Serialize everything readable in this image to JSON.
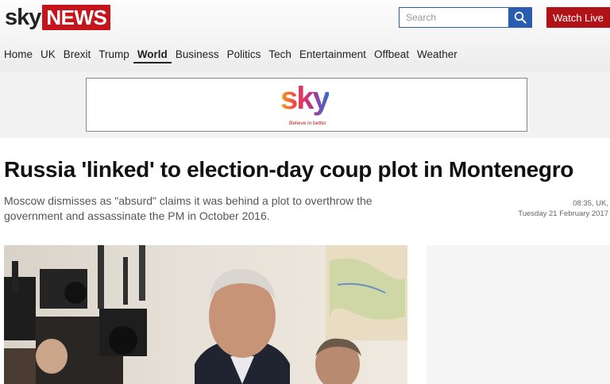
{
  "header": {
    "logo": {
      "sky": "sky",
      "news": "NEWS"
    },
    "search": {
      "placeholder": "Search"
    },
    "watch_live": "Watch Live",
    "nav": [
      {
        "label": "Home"
      },
      {
        "label": "UK"
      },
      {
        "label": "Brexit"
      },
      {
        "label": "Trump"
      },
      {
        "label": "World",
        "active": true
      },
      {
        "label": "Business"
      },
      {
        "label": "Politics"
      },
      {
        "label": "Tech"
      },
      {
        "label": "Entertainment"
      },
      {
        "label": "Offbeat"
      },
      {
        "label": "Weather"
      }
    ]
  },
  "ad": {
    "logo": "sky",
    "tagline": "Believe in better"
  },
  "article": {
    "headline": "Russia 'linked' to election-day coup plot in Montenegro",
    "standfirst": "Moscow dismisses as \"absurd\" claims it was behind a plot to overthrow the government and assassinate the PM in October 2016.",
    "time": "08:35, UK,",
    "date": "Tuesday 21 February 2017"
  },
  "colors": {
    "brand_red": "#c4151c",
    "search_blue": "#2a5db0",
    "watch_red": "#b01218"
  },
  "icons": {
    "search": "search-icon"
  }
}
